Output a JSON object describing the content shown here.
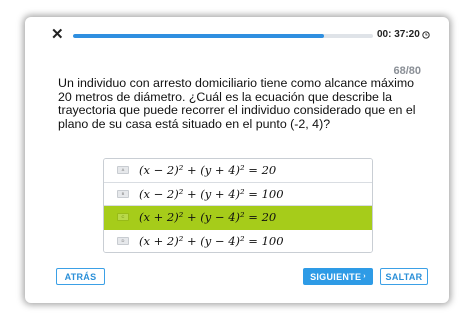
{
  "header": {
    "close_label": "✕",
    "progress_fraction": 0.835,
    "timer": "00: 37:20"
  },
  "question": {
    "counter": "68/80",
    "text": "Un individuo con arresto domiciliario tiene como alcance máximo 20 metros de diámetro. ¿Cuál es la ecuación que describe la trayectoria que puede recorrer el individuo considerado que en el plano de su casa está situado en el punto (-2, 4)?"
  },
  "options": [
    {
      "letter": "A",
      "text": "(x − 2)² + (y + 4)² = 20",
      "selected": false
    },
    {
      "letter": "B",
      "text": "(x − 2)² + (y + 4)² = 100",
      "selected": false
    },
    {
      "letter": "C",
      "text": "(x + 2)² + (y − 4)² = 20",
      "selected": true
    },
    {
      "letter": "D",
      "text": "(x + 2)² + (y − 4)² = 100",
      "selected": false
    }
  ],
  "buttons": {
    "back": "ATRÁS",
    "next": "SIGUIENTE",
    "skip": "SALTAR"
  },
  "colors": {
    "accent_blue": "#2e9be6",
    "selected_green": "#a6cc1a"
  }
}
